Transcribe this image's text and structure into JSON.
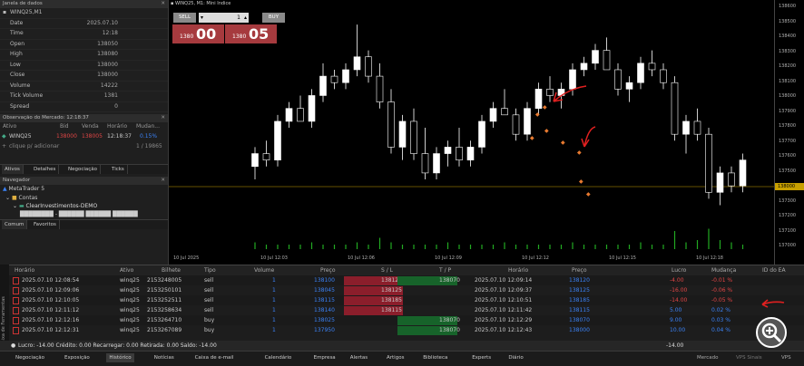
{
  "data_window": {
    "title": "Janela de dados",
    "symbol": "WINQ25,M1",
    "rows": [
      {
        "label": "Date",
        "value": "2025.07.10"
      },
      {
        "label": "Time",
        "value": "12:18"
      },
      {
        "label": "Open",
        "value": "138050"
      },
      {
        "label": "High",
        "value": "138080"
      },
      {
        "label": "Low",
        "value": "138000"
      },
      {
        "label": "Close",
        "value": "138000"
      },
      {
        "label": "Volume",
        "value": "14222"
      },
      {
        "label": "Tick Volume",
        "value": "1381"
      },
      {
        "label": "Spread",
        "value": "0"
      }
    ]
  },
  "market_watch": {
    "title": "Observação do Mercado: 12:18:37",
    "headers": [
      "Ativo",
      "Bid",
      "Venda",
      "Horário",
      "Mudan..."
    ],
    "rows": [
      {
        "symbol": "WINQ25",
        "bid": "138000",
        "ask": "138005",
        "time": "12:18:37",
        "change": "0.15%"
      },
      {
        "symbol": "clique p/ adicionar",
        "bid": "",
        "ask": "",
        "time": "",
        "change": "1 / 19865"
      }
    ],
    "tabs": [
      "Ativos",
      "Detalhes",
      "Negociação",
      "Ticks"
    ]
  },
  "navigator": {
    "title": "Navegador",
    "items": [
      "MetaTrader 5",
      "Contas",
      "ClearInvestimentos-DEMO",
      "████████ - ██████ ██████ ██████"
    ],
    "tabs": [
      "Comum",
      "Favoritos"
    ]
  },
  "chart": {
    "title": "WINQ25, M1: Mini Indice",
    "sell_label": "SELL",
    "buy_label": "BUY",
    "lot": "1",
    "sell_price_small": "1380",
    "sell_price_big": "00",
    "buy_price_small": "1380",
    "buy_price_big": "05",
    "current_price_label": "138000",
    "price_ticks": [
      "138600",
      "138500",
      "138400",
      "138300",
      "138200",
      "138100",
      "138000",
      "137900",
      "137800",
      "137700",
      "137600",
      "137500",
      "137400",
      "137300",
      "137200",
      "137100",
      "137000"
    ],
    "time_ticks": [
      "10 Jul 2025",
      "10 Jul 12:03",
      "10 Jul 12:06",
      "10 Jul 12:09",
      "10 Jul 12:12",
      "10 Jul 12:15",
      "10 Jul 12:18"
    ],
    "colors": {
      "bull": "#ffffff",
      "bear": "#ffffff",
      "volume": "#22aa22",
      "priceline": "#c8a000",
      "annotation": "#e02020"
    }
  },
  "chart_data": {
    "type": "candlestick",
    "candles": [
      [
        137500,
        137650,
        137400,
        137600
      ],
      [
        137600,
        137700,
        137500,
        137550
      ],
      [
        137550,
        137900,
        137500,
        137850
      ],
      [
        137850,
        138000,
        137800,
        137950
      ],
      [
        137950,
        138050,
        137900,
        137850
      ],
      [
        137850,
        138100,
        137800,
        138050
      ],
      [
        138050,
        138300,
        138000,
        138200
      ],
      [
        138200,
        138250,
        138100,
        138150
      ],
      [
        138150,
        138300,
        138100,
        138250
      ],
      [
        138250,
        138600,
        138200,
        138350
      ],
      [
        138350,
        138400,
        138150,
        138200
      ],
      [
        138200,
        138300,
        137950,
        138000
      ],
      [
        138000,
        138100,
        137600,
        137650
      ],
      [
        137650,
        137900,
        137550,
        137850
      ],
      [
        137850,
        137950,
        137550,
        137600
      ],
      [
        137600,
        137800,
        137400,
        137450
      ],
      [
        137450,
        137650,
        137400,
        137600
      ],
      [
        137600,
        137700,
        137500,
        137650
      ],
      [
        137650,
        137800,
        137500,
        137550
      ],
      [
        137550,
        137700,
        137500,
        137650
      ],
      [
        137650,
        137900,
        137600,
        137850
      ],
      [
        137850,
        138000,
        137800,
        137950
      ],
      [
        137950,
        138100,
        137900,
        137900
      ],
      [
        137900,
        137950,
        137700,
        137750
      ],
      [
        137750,
        138000,
        137700,
        137950
      ],
      [
        137950,
        138150,
        137900,
        138100
      ],
      [
        138100,
        138200,
        138000,
        138050
      ],
      [
        138050,
        138150,
        137950,
        138100
      ],
      [
        138100,
        138300,
        138050,
        138250
      ],
      [
        138250,
        138350,
        138200,
        138300
      ],
      [
        138300,
        138450,
        138250,
        138400
      ],
      [
        138400,
        138500,
        138300,
        138250
      ],
      [
        138250,
        138300,
        138050,
        138100
      ],
      [
        138100,
        138200,
        138000,
        138150
      ],
      [
        138150,
        138350,
        138100,
        138300
      ],
      [
        138300,
        138400,
        138200,
        138250
      ],
      [
        138250,
        138300,
        138100,
        138150
      ],
      [
        138150,
        138200,
        137700,
        137750
      ],
      [
        137750,
        137900,
        137600,
        137850
      ],
      [
        137850,
        137950,
        137700,
        137750
      ],
      [
        137750,
        137800,
        137250,
        137300
      ],
      [
        137300,
        137500,
        137200,
        137450
      ],
      [
        137450,
        137500,
        137300,
        137350
      ],
      [
        137350,
        137600,
        137300,
        137550
      ]
    ],
    "volume": [
      3,
      2,
      2,
      2,
      2,
      3,
      2,
      2,
      2,
      3,
      2,
      5,
      3,
      2,
      2,
      2,
      2,
      3,
      2,
      2,
      2,
      2,
      3,
      2,
      2,
      2,
      2,
      2,
      3,
      2,
      2,
      2,
      2,
      2,
      3,
      2,
      2,
      8,
      3,
      4,
      9,
      4,
      3,
      2
    ],
    "ylim": [
      137000,
      138650
    ]
  },
  "trades_table": {
    "headers": [
      "Horário",
      "Ativo",
      "Bilhete",
      "Tipo",
      "Volume",
      "Preço",
      "S / L",
      "T / P",
      "Horário",
      "Preço",
      "Lucro",
      "Mudança",
      "ID do EA"
    ],
    "rows": [
      {
        "time": "2025.07.10 12:08:54",
        "symbol": "winq25",
        "ticket": "2153248005",
        "type": "sell",
        "volume": "1",
        "price": "138100",
        "sl": "138120",
        "tp": "138070",
        "time2": "2025.07.10 12:09:14",
        "price2": "138120",
        "profit": "-4.00",
        "change": "-0.01 %",
        "id": ""
      },
      {
        "time": "2025.07.10 12:09:06",
        "symbol": "winq25",
        "ticket": "2153250101",
        "type": "sell",
        "volume": "1",
        "price": "138045",
        "sl": "138125",
        "tp": "",
        "time2": "2025.07.10 12:09:37",
        "price2": "138125",
        "profit": "-16.00",
        "change": "-0.06 %",
        "id": ""
      },
      {
        "time": "2025.07.10 12:10:05",
        "symbol": "winq25",
        "ticket": "2153252511",
        "type": "sell",
        "volume": "1",
        "price": "138115",
        "sl": "138185",
        "tp": "",
        "time2": "2025.07.10 12:10:51",
        "price2": "138185",
        "profit": "-14.00",
        "change": "-0.05 %",
        "id": ""
      },
      {
        "time": "2025.07.10 12:11:12",
        "symbol": "winq25",
        "ticket": "2153258634",
        "type": "sell",
        "volume": "1",
        "price": "138140",
        "sl": "138115",
        "tp": "",
        "time2": "2025.07.10 12:11:42",
        "price2": "138115",
        "profit": "5.00",
        "change": "0.02 %",
        "id": ""
      },
      {
        "time": "2025.07.10 12:12:16",
        "symbol": "winq25",
        "ticket": "2153264710",
        "type": "buy",
        "volume": "1",
        "price": "138025",
        "sl": "",
        "tp": "138070",
        "time2": "2025.07.10 12:12:29",
        "price2": "138070",
        "profit": "9.00",
        "change": "0.03 %",
        "id": ""
      },
      {
        "time": "2025.07.10 12:12:31",
        "symbol": "winq25",
        "ticket": "2153267089",
        "type": "buy",
        "volume": "1",
        "price": "137950",
        "sl": "",
        "tp": "138070",
        "time2": "2025.07.10 12:12:43",
        "price2": "138000",
        "profit": "10.00",
        "change": "0.04 %",
        "id": ""
      }
    ],
    "summary": "Lucro: -14.00  Crédito: 0.00  Recarregar: 0.00  Retirada: 0.00  Saldo: -14.00",
    "summary_total": "-14.00",
    "side_label": "Caixa de Ferramentas"
  },
  "bottom_tabs": [
    "Negociação",
    "Exposição",
    "Histórico",
    "Notícias",
    "Caixa de e-mail",
    "Calendário",
    "Empresa",
    "Alertas",
    "Artigos",
    "Biblioteca",
    "Experts",
    "Diário"
  ],
  "active_bottom_tab": "Histórico",
  "status_right": [
    "Mercado",
    "VPS Sinais",
    "VPS"
  ]
}
